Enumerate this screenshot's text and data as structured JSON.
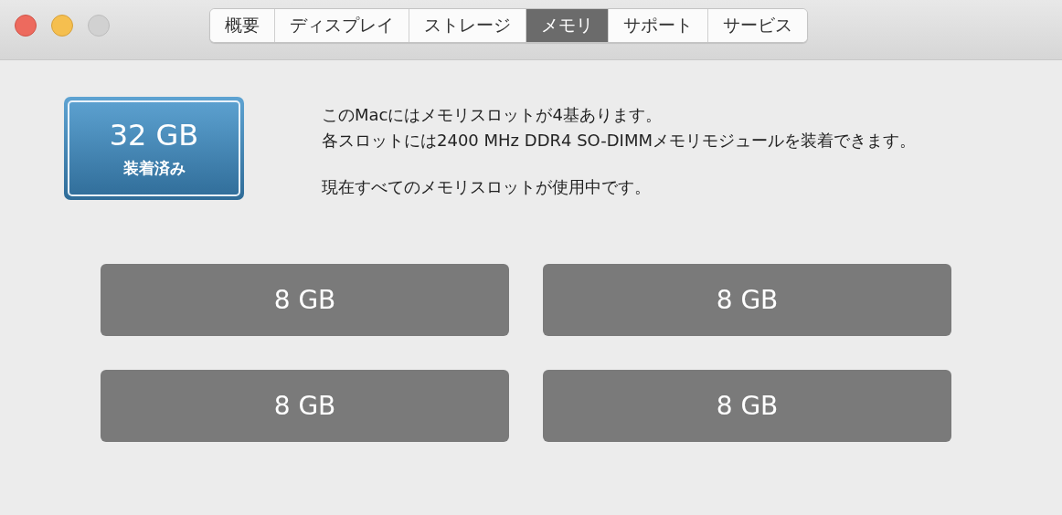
{
  "window": {
    "buttons": [
      {
        "kind": "close"
      },
      {
        "kind": "minimize"
      },
      {
        "kind": "zoom",
        "disabled": true
      }
    ]
  },
  "tabs": [
    {
      "label": "概要",
      "selected": false
    },
    {
      "label": "ディスプレイ",
      "selected": false
    },
    {
      "label": "ストレージ",
      "selected": false
    },
    {
      "label": "メモリ",
      "selected": true
    },
    {
      "label": "サポート",
      "selected": false
    },
    {
      "label": "サービス",
      "selected": false
    }
  ],
  "summary": {
    "amount": "32 GB",
    "caption": "装着済み"
  },
  "description": [
    "このMacにはメモリスロットが4基あります。",
    "各スロットには2400 MHz DDR4 SO-DIMMメモリモジュールを装着できます。",
    "現在すべてのメモリスロットが使用中です。"
  ],
  "slots": [
    {
      "label": "8 GB"
    },
    {
      "label": "8 GB"
    },
    {
      "label": "8 GB"
    },
    {
      "label": "8 GB"
    }
  ]
}
